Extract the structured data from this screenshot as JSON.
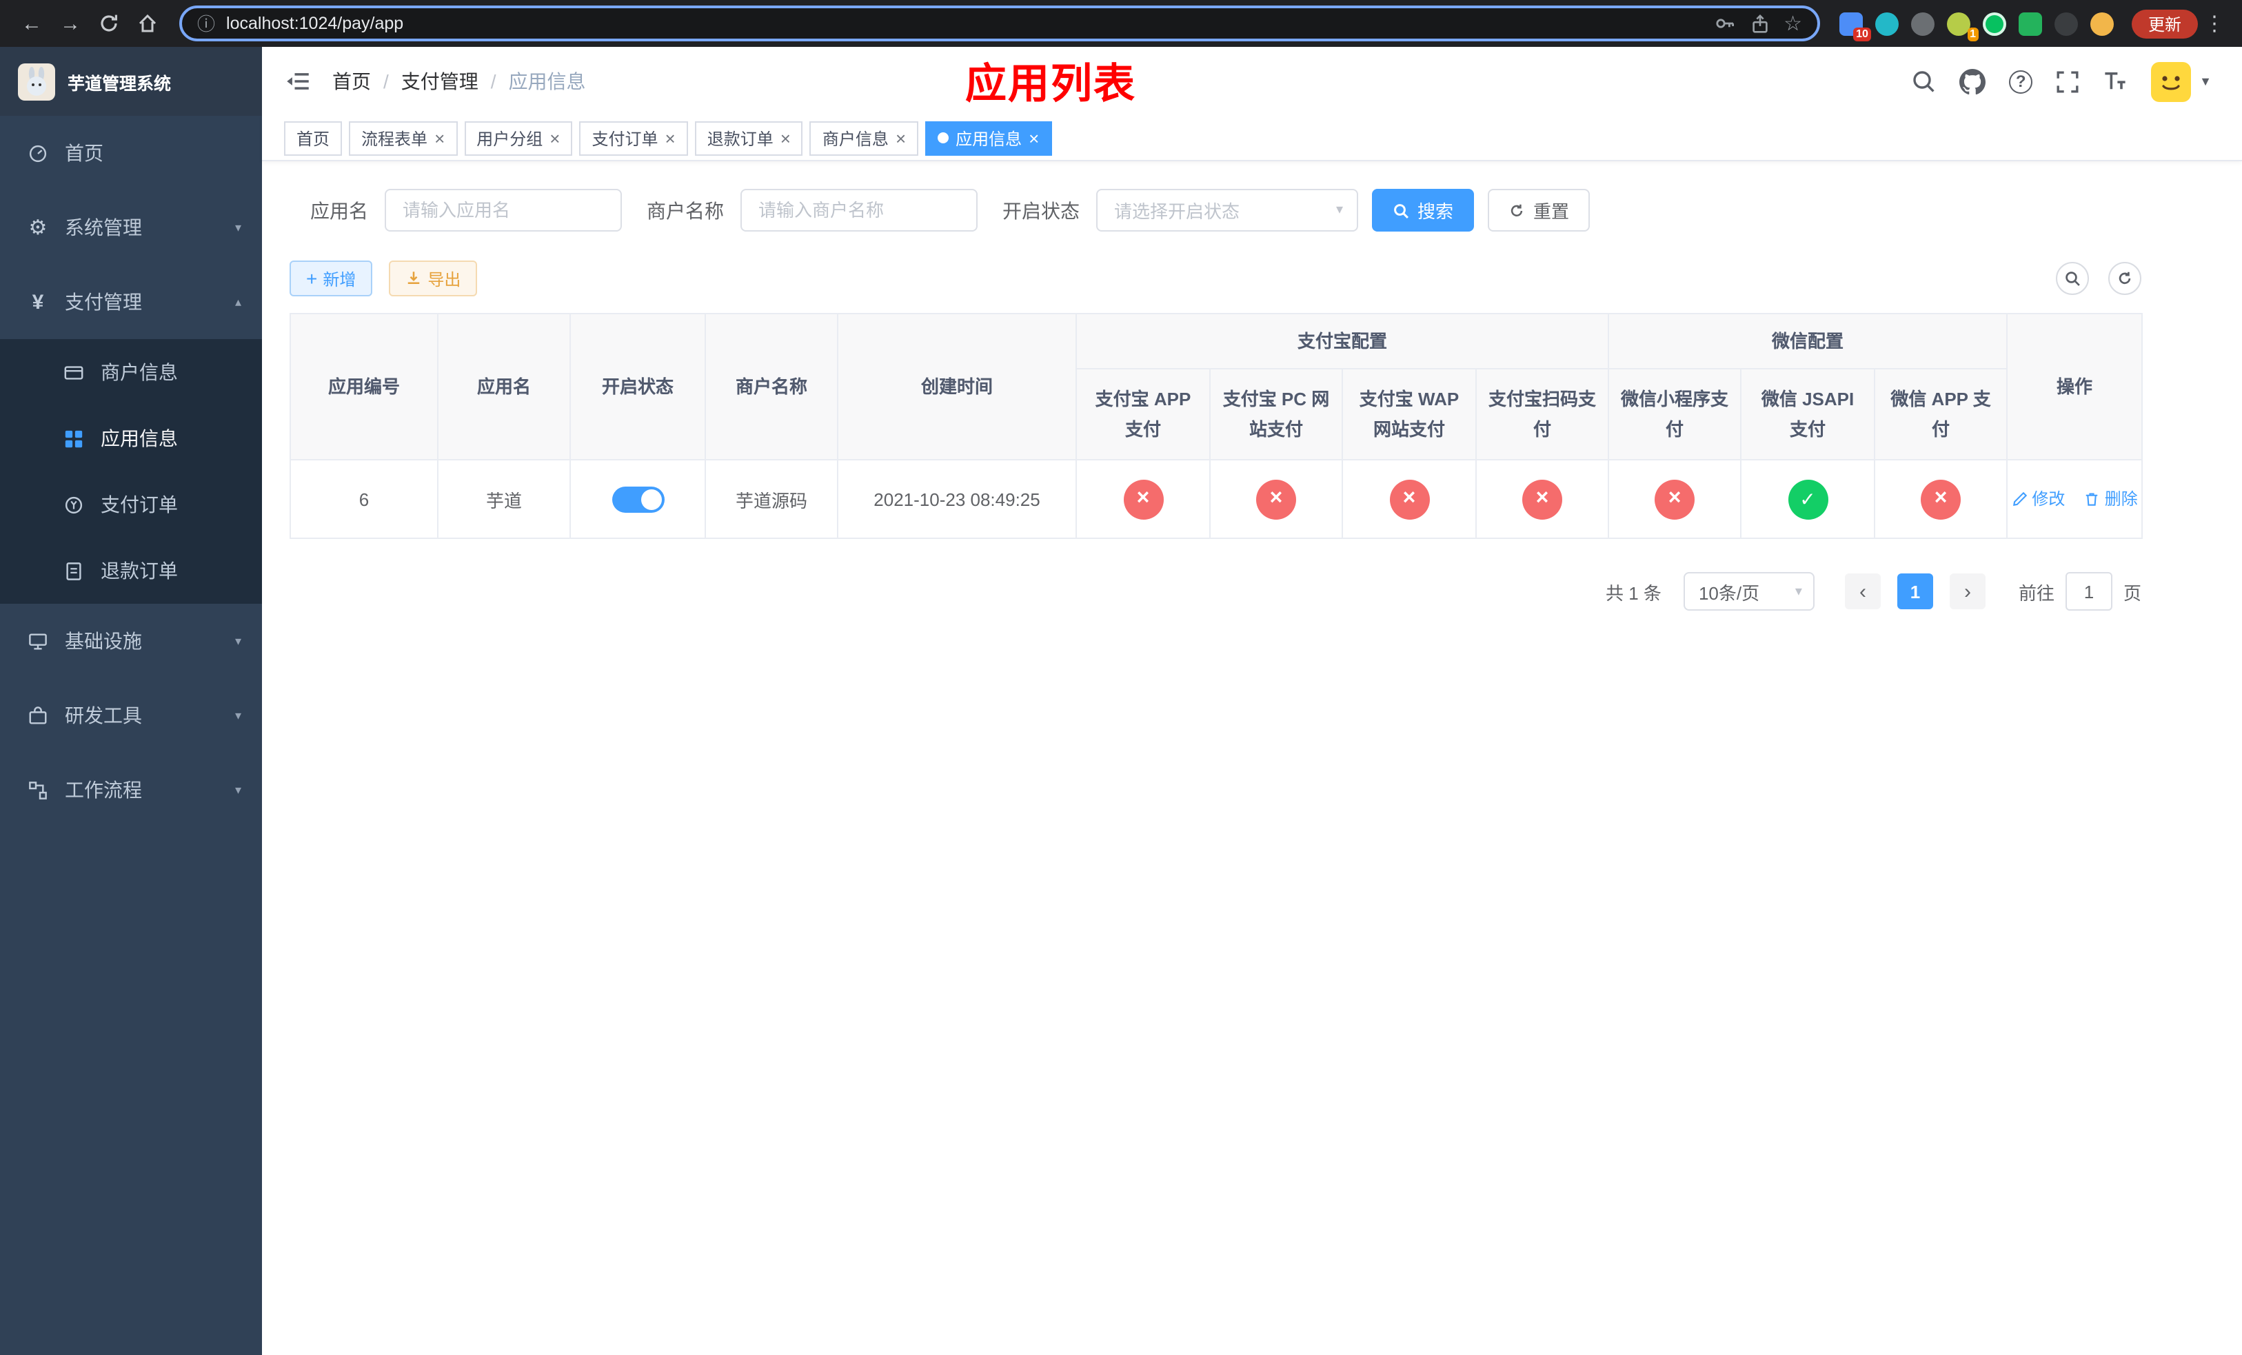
{
  "browser": {
    "url": "localhost:1024/pay/app",
    "update_label": "更新",
    "ext_badge_a": "10",
    "ext_badge_b": "1"
  },
  "icons": {
    "back": "←",
    "forward": "→",
    "info": "ⓘ",
    "star": "☆",
    "kebab": "⋮",
    "close": "×",
    "chevron_down": "▾",
    "chevron_up": "▴",
    "caret_down": "▼",
    "prev": "‹",
    "next": "›",
    "plus": "+",
    "gear": "⚙",
    "yen": "¥",
    "question": "?",
    "slash": "/"
  },
  "sidebar": {
    "logo_title": "芋道管理系统",
    "menu": [
      {
        "label": "首页"
      },
      {
        "label": "系统管理"
      },
      {
        "label": "支付管理"
      },
      {
        "label": "商户信息"
      },
      {
        "label": "应用信息"
      },
      {
        "label": "支付订单"
      },
      {
        "label": "退款订单"
      },
      {
        "label": "基础设施"
      },
      {
        "label": "研发工具"
      },
      {
        "label": "工作流程"
      }
    ]
  },
  "header": {
    "breadcrumb": [
      "首页",
      "支付管理",
      "应用信息"
    ],
    "page_title": "应用列表"
  },
  "tabs": [
    {
      "label": "首页"
    },
    {
      "label": "流程表单"
    },
    {
      "label": "用户分组"
    },
    {
      "label": "支付订单"
    },
    {
      "label": "退款订单"
    },
    {
      "label": "商户信息"
    },
    {
      "label": "应用信息"
    }
  ],
  "filters": {
    "app_name_label": "应用名",
    "app_name_placeholder": "请输入应用名",
    "merchant_label": "商户名称",
    "merchant_placeholder": "请输入商户名称",
    "status_label": "开启状态",
    "status_placeholder": "请选择开启状态",
    "search_label": "搜索",
    "reset_label": "重置"
  },
  "toolbar": {
    "add_label": "新增",
    "export_label": "导出"
  },
  "table": {
    "group_alipay": "支付宝配置",
    "group_wechat": "微信配置",
    "columns": [
      "应用编号",
      "应用名",
      "开启状态",
      "商户名称",
      "创建时间",
      "支付宝 APP 支付",
      "支付宝 PC 网站支付",
      "支付宝 WAP 网站支付",
      "支付宝扫码支付",
      "微信小程序支付",
      "微信 JSAPI 支付",
      "微信 APP 支付",
      "操作"
    ],
    "rows": [
      {
        "id": "6",
        "name": "芋道",
        "enabled": "true",
        "merchant": "芋道源码",
        "created": "2021-10-23 08:49:25",
        "configs": [
          "no",
          "no",
          "no",
          "no",
          "no",
          "yes",
          "no"
        ],
        "edit_label": "修改",
        "delete_label": "删除"
      }
    ]
  },
  "pagination": {
    "total": "共 1 条",
    "page_size": "10条/页",
    "page": "1",
    "goto_label": "前往",
    "goto_value": "1",
    "goto_suffix": "页"
  },
  "colors": {
    "accent": "#409eff",
    "success": "#13ce66",
    "danger": "#f56c6c",
    "warning": "#e6a23c",
    "sidebar_bg": "#304156",
    "title_red": "#ff0000"
  }
}
